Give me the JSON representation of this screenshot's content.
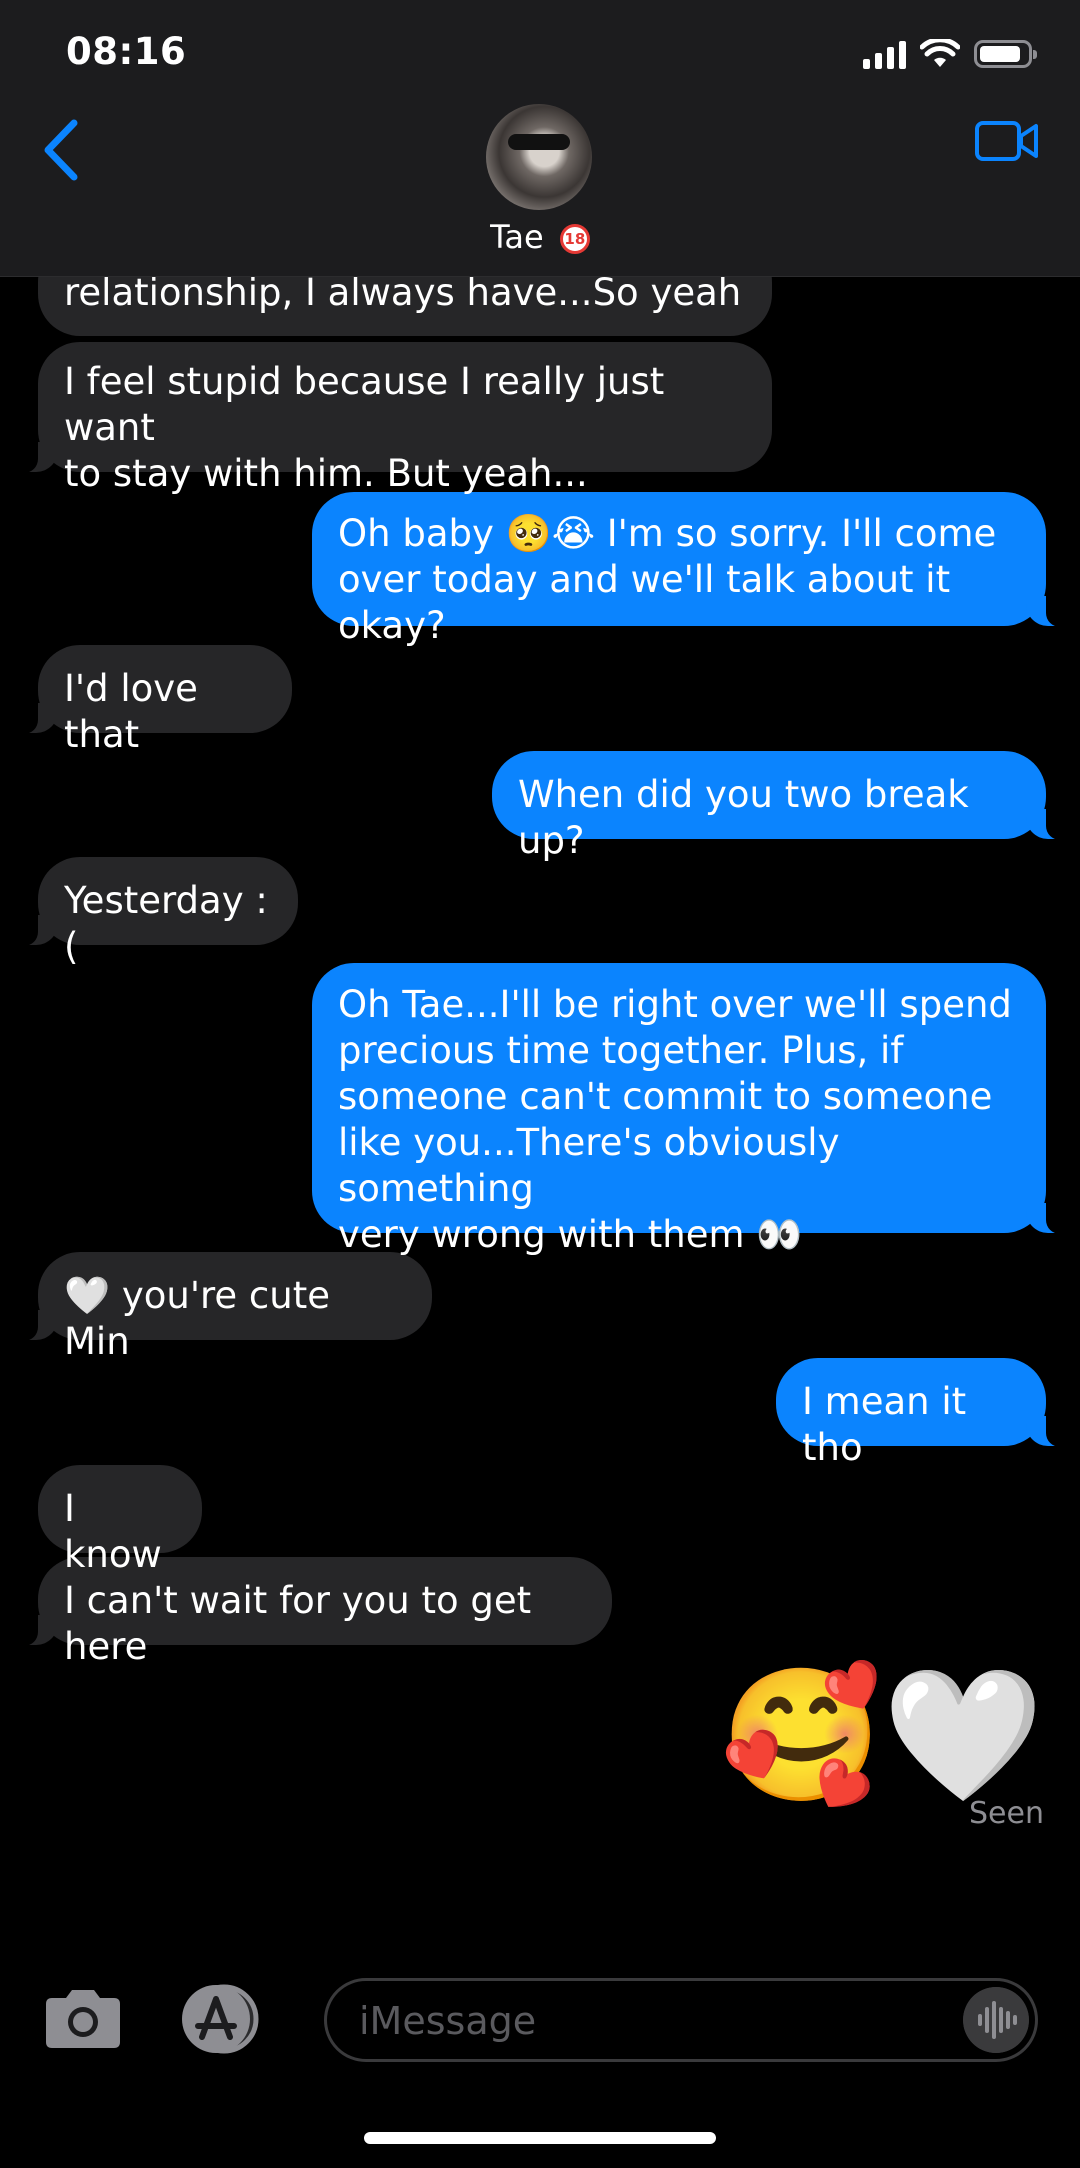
{
  "status": {
    "time": "08:16"
  },
  "header": {
    "contact_name": "Tae",
    "contact_badge": "18"
  },
  "messages": [
    {
      "dir": "in",
      "text": "relationship, I always have...So yeah"
    },
    {
      "dir": "in",
      "text": "I feel stupid because I really just want\nto stay with him. But yeah..."
    },
    {
      "dir": "out",
      "text": "Oh baby 🥺😭 I'm so sorry. I'll come\nover today and we'll talk about it okay?"
    },
    {
      "dir": "in",
      "text": "I'd love that"
    },
    {
      "dir": "out",
      "text": "When did you two break up?"
    },
    {
      "dir": "in",
      "text": "Yesterday :("
    },
    {
      "dir": "out",
      "text": "Oh Tae...I'll be right over we'll spend\nprecious time together. Plus, if\nsomeone can't commit to someone\nlike you...There's obviously something\nvery wrong with them 👀"
    },
    {
      "dir": "in",
      "text": "🤍 you're cute Min"
    },
    {
      "dir": "out",
      "text": "I mean it tho"
    },
    {
      "dir": "in",
      "text": "I know"
    },
    {
      "dir": "in",
      "text": "I can't wait for you to get here"
    },
    {
      "dir": "out",
      "text": "🥰🤍"
    }
  ],
  "read_receipt": "Seen",
  "input": {
    "placeholder": "iMessage"
  },
  "icons": {
    "back": "chevron-left-icon",
    "video": "video-camera-icon",
    "camera": "camera-icon",
    "apps": "app-store-icon",
    "mic": "audio-waveform-icon"
  },
  "colors": {
    "accent": "#0b84fe",
    "incoming_bubble": "#262628",
    "background": "#000000"
  }
}
